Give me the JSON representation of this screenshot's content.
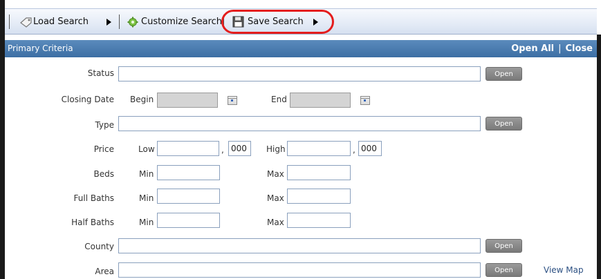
{
  "toolbar": {
    "load_label": "Load Search",
    "customize_label": "Customize Search",
    "save_label": "Save Search"
  },
  "panel": {
    "title": "Primary Criteria",
    "open_all": "Open All",
    "divider": "|",
    "close": "Close"
  },
  "rows": {
    "status": "Status",
    "closing_date": "Closing Date",
    "begin": "Begin",
    "end": "End",
    "type": "Type",
    "price": "Price",
    "low": "Low",
    "high": "High",
    "low_thousands": "000",
    "high_thousands": "000",
    "comma": ",",
    "beds": "Beds",
    "full_baths": "Full Baths",
    "half_baths": "Half Baths",
    "min": "Min",
    "max": "Max",
    "county": "County",
    "area": "Area"
  },
  "buttons": {
    "open": "Open"
  },
  "links": {
    "view_map": "View Map"
  },
  "colors": {
    "accent_header": "#3c6ea4",
    "highlight_ring": "#e41d1d",
    "open_button": "#8a8a8a"
  },
  "icons": [
    "load-search-icon",
    "customize-gear-icon",
    "save-disk-icon",
    "calendar-icon"
  ]
}
